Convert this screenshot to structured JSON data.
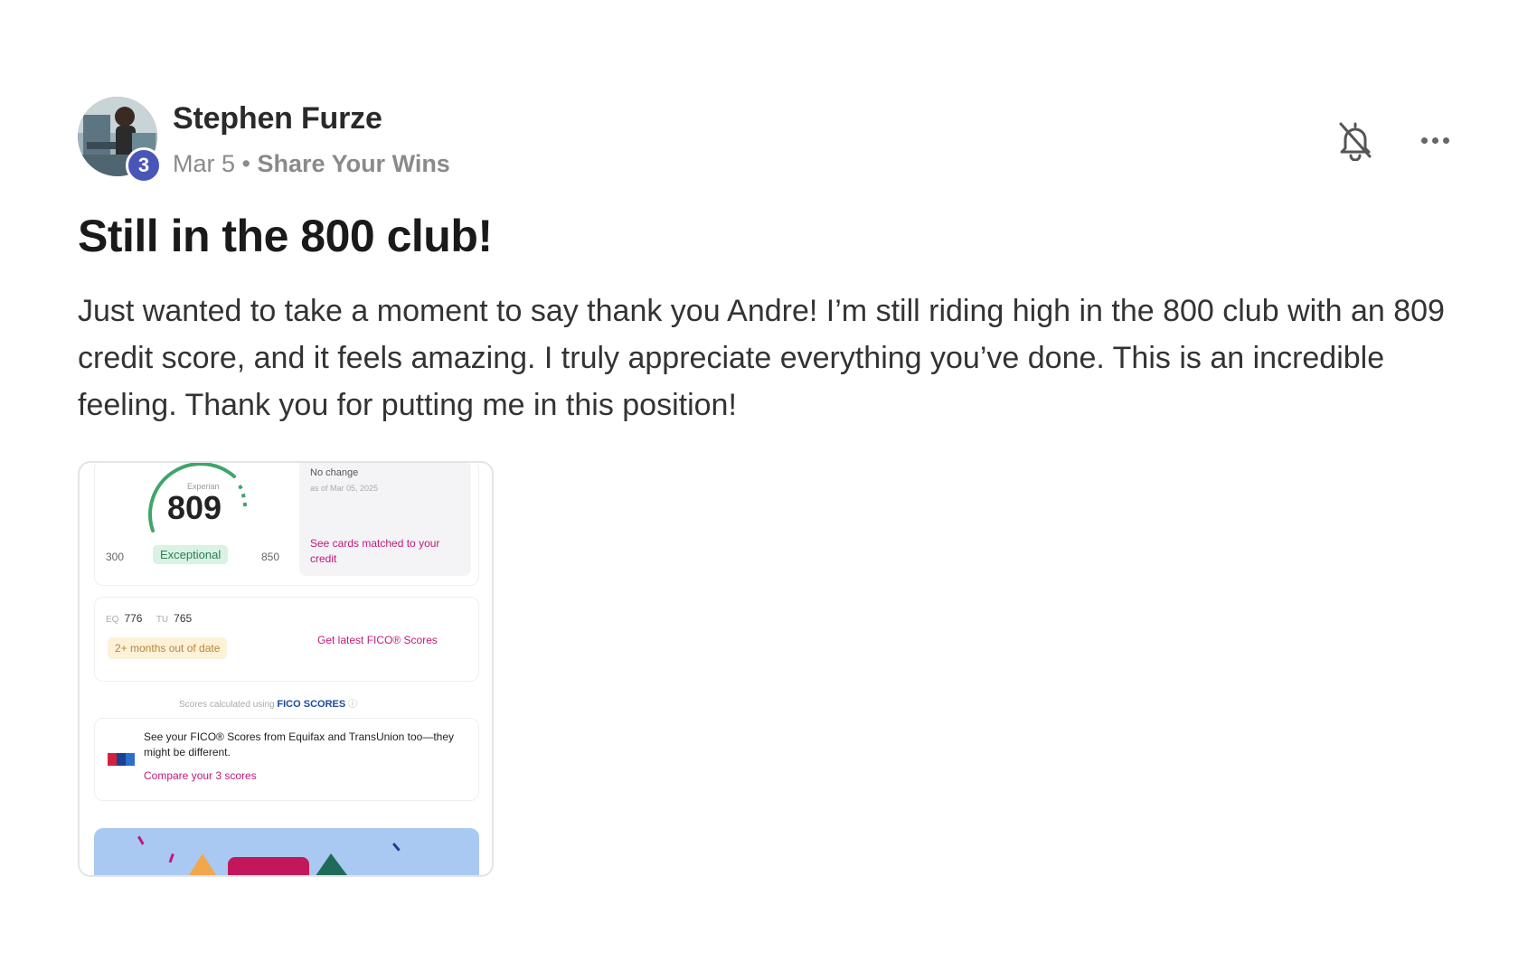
{
  "author": {
    "name": "Stephen Furze",
    "level": "3",
    "date": "Mar 5",
    "separator": "•",
    "category": "Share Your Wins"
  },
  "post": {
    "title": "Still in the 800 club!",
    "body": "Just wanted to take a moment to say thank you Andre! I’m still riding high in the 800 club with an 809 credit score, and it feels amazing. I truly appreciate everything you’ve done. This is an incredible feeling. Thank you for putting me in this position!"
  },
  "icons": {
    "bell": "bell-off-icon",
    "more": "more-horizontal-icon"
  },
  "attachment": {
    "bureau": "Experian",
    "score": "809",
    "range_low": "300",
    "range_high": "850",
    "rating": "Exceptional",
    "no_change": "No change",
    "as_of": "as of Mar 05, 2025",
    "cards_link": "See cards matched to your credit",
    "score_a": "776",
    "score_b": "765",
    "stale": "2+ months out of date",
    "fico_link": "Get latest FICO® Scores",
    "calc_label": "Scores calculated using",
    "calc_brand": "FICO SCORES",
    "compare_text": "See your FICO® Scores from Equifax and TransUnion too—they might be different.",
    "compare_link": "Compare your 3 scores"
  },
  "colors": {
    "badge": "#4a55b8",
    "link": "#c2187a",
    "gauge": "#3fa56a",
    "banner": "#a9c9f3"
  }
}
